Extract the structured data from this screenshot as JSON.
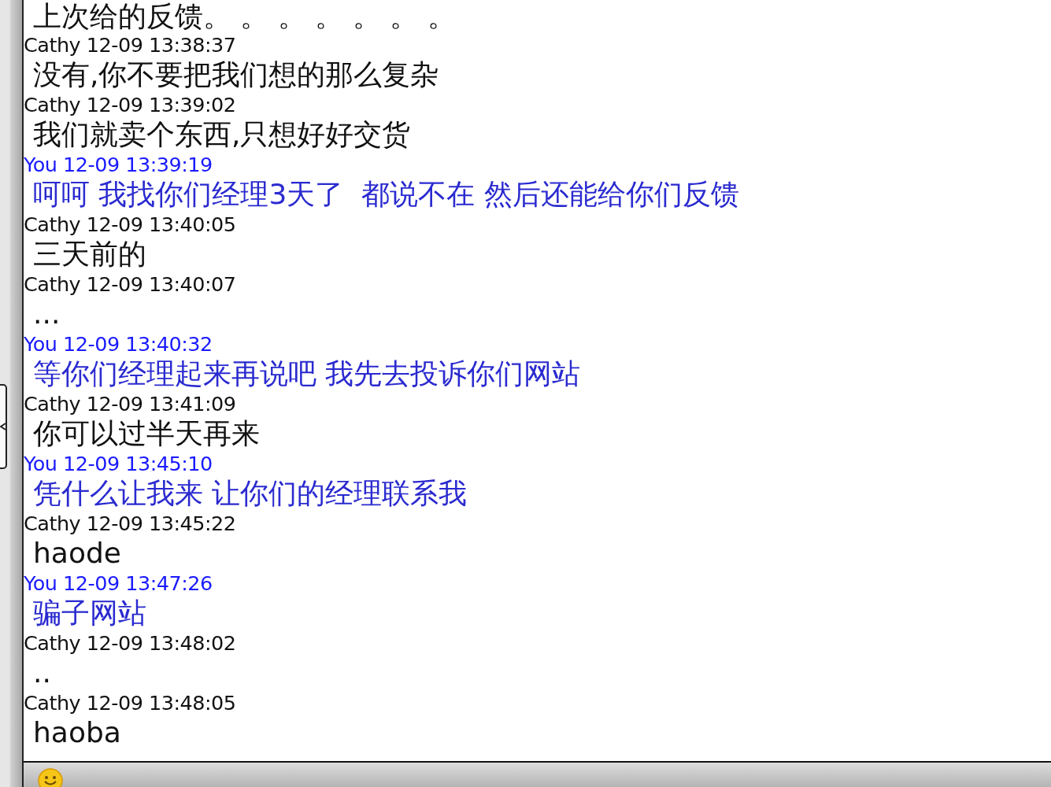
{
  "chat": {
    "messages": [
      {
        "kind": "other",
        "text": "上次给的反馈。 。 。 。 。 。 。"
      },
      {
        "kind": "other",
        "header": "Cathy 12-09 13:38:37",
        "text": "没有,你不要把我们想的那么复杂"
      },
      {
        "kind": "other",
        "header": "Cathy 12-09 13:39:02",
        "text": "我们就卖个东西,只想好好交货"
      },
      {
        "kind": "you",
        "header": "You 12-09 13:39:19",
        "text": "呵呵 我找你们经理3天了  都说不在 然后还能给你们反馈"
      },
      {
        "kind": "other",
        "header": "Cathy 12-09 13:40:05",
        "text": "三天前的"
      },
      {
        "kind": "other",
        "header": "Cathy 12-09 13:40:07",
        "text": "..."
      },
      {
        "kind": "you",
        "header": "You 12-09 13:40:32",
        "text": "等你们经理起来再说吧 我先去投诉你们网站"
      },
      {
        "kind": "other",
        "header": "Cathy 12-09 13:41:09",
        "text": "你可以过半天再来"
      },
      {
        "kind": "you",
        "header": "You 12-09 13:45:10",
        "text": "凭什么让我来 让你们的经理联系我"
      },
      {
        "kind": "other",
        "header": "Cathy 12-09 13:45:22",
        "text": "haode"
      },
      {
        "kind": "you",
        "header": "You 12-09 13:47:26",
        "text": "骗子网站"
      },
      {
        "kind": "other",
        "header": "Cathy 12-09 13:48:02",
        "text": ".."
      },
      {
        "kind": "other",
        "header": "Cathy 12-09 13:48:05",
        "text": "haoba"
      }
    ]
  }
}
